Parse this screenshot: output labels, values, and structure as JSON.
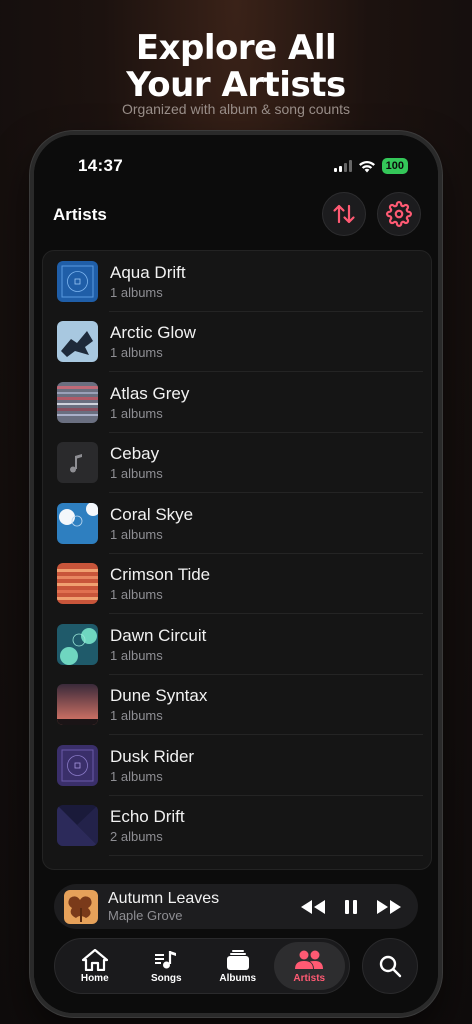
{
  "promo": {
    "headline_line1": "Explore All",
    "headline_line2": "Your Artists",
    "subline": "Organized with album & song counts"
  },
  "status_bar": {
    "time": "14:37",
    "battery": "100"
  },
  "nav": {
    "title": "Artists",
    "sort_icon": "sort-arrows-icon",
    "settings_icon": "gear-icon"
  },
  "accent_color": "#ff5a73",
  "artists": [
    {
      "name": "Aqua Drift",
      "albums": "1 albums"
    },
    {
      "name": "Arctic Glow",
      "albums": "1 albums"
    },
    {
      "name": "Atlas Grey",
      "albums": "1 albums"
    },
    {
      "name": "Cebay",
      "albums": "1 albums"
    },
    {
      "name": "Coral Skye",
      "albums": "1 albums"
    },
    {
      "name": "Crimson Tide",
      "albums": "1 albums"
    },
    {
      "name": "Dawn Circuit",
      "albums": "1 albums"
    },
    {
      "name": "Dune Syntax",
      "albums": "1 albums"
    },
    {
      "name": "Dusk Rider",
      "albums": "1 albums"
    },
    {
      "name": "Echo Drift",
      "albums": "2 albums"
    }
  ],
  "now_playing": {
    "title": "Autumn Leaves",
    "artist": "Maple Grove"
  },
  "tabs": [
    {
      "label": "Home",
      "icon": "house-icon"
    },
    {
      "label": "Songs",
      "icon": "music-note-icon"
    },
    {
      "label": "Albums",
      "icon": "album-stack-icon"
    },
    {
      "label": "Artists",
      "icon": "people-icon",
      "active": true
    }
  ],
  "search_icon": "search-icon"
}
